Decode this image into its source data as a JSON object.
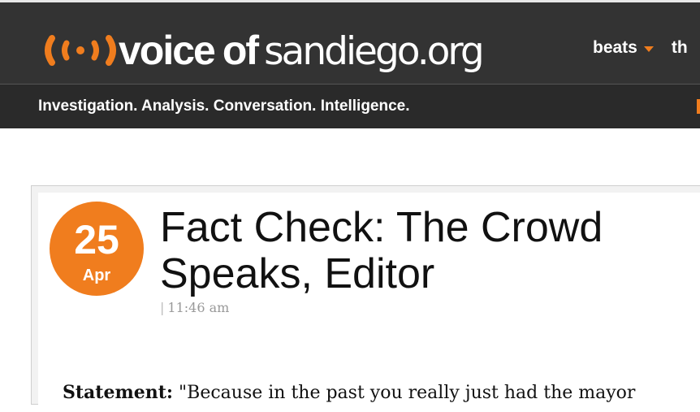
{
  "header": {
    "logo": {
      "word_voice": "voice",
      "word_of": "of",
      "word_domain": "sandiego.org"
    },
    "nav": [
      {
        "label": "beats",
        "has_dropdown": true
      },
      {
        "label": "th"
      }
    ],
    "tagline": "Investigation. Analysis. Conversation. Intelligence."
  },
  "article": {
    "date": {
      "day": "25",
      "month": "Apr"
    },
    "title": "Fact Check: The Crowd Speaks, Editor",
    "time": "11:46 am",
    "statement": {
      "label": "Statement:",
      "text": "\"Because in the past you really just had the mayor"
    }
  },
  "colors": {
    "brand_orange": "#f07d1e",
    "header_bg": "#333333",
    "tagbar_bg": "#2a2a2a"
  },
  "icons": [
    "signal-broadcast-icon",
    "dropdown-caret-icon"
  ]
}
